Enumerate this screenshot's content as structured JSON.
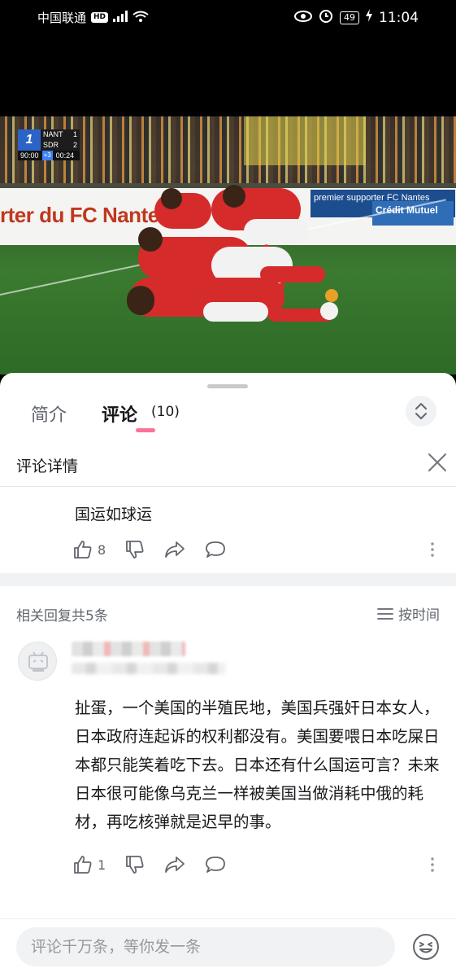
{
  "status_bar": {
    "carrier": "中国联通",
    "hd": "HD",
    "battery": "49",
    "time": "11:04"
  },
  "video": {
    "banner_text": "rter du FC Nantes",
    "banner_right_text": "premier supporter  FC Nantes",
    "banner_sponsor": "Crédit Mutuel",
    "scoreboard": {
      "logo": "1",
      "team1": "NANT",
      "score1": "1",
      "team2": "SDR",
      "score2": "2",
      "match_time": "90:00",
      "added": "+3",
      "elapsed": "00:24"
    }
  },
  "tabs": {
    "intro": "简介",
    "comments": "评论",
    "comment_count": "(10)"
  },
  "detail": {
    "title": "评论详情"
  },
  "main_comment": {
    "text": "国运如球运",
    "likes": "8"
  },
  "replies": {
    "count_label": "相关回复共5条",
    "sort_label": "按时间",
    "items": [
      {
        "text": "扯蛋，一个美国的半殖民地，美国兵强奸日本女人，日本政府连起诉的权利都没有。美国要喂日本吃屎日本都只能笑着吃下去。日本还有什么国运可言？未来日本很可能像乌克兰一样被美国当做消耗中俄的耗材，再吃核弹就是迟早的事。",
        "likes": "1"
      }
    ]
  },
  "input": {
    "placeholder": "评论千万条，等你发一条"
  },
  "colors": {
    "accent_pink": "#fb7299",
    "text_primary": "#18191c",
    "text_secondary": "#61666d"
  }
}
